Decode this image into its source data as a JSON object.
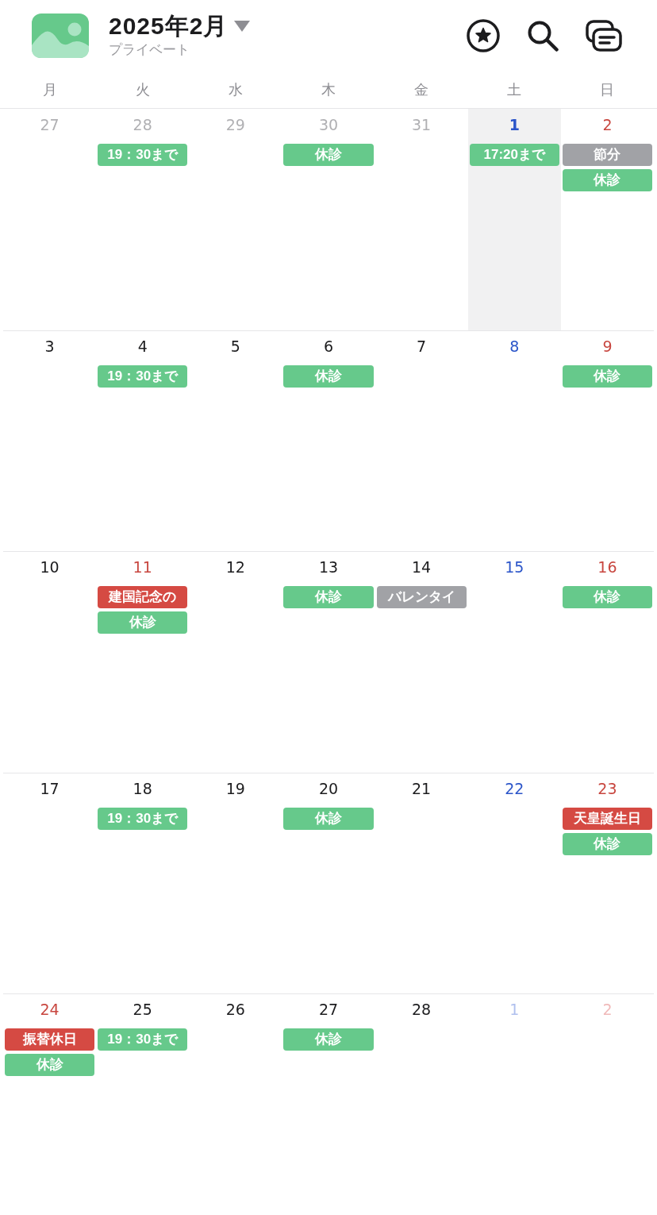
{
  "header": {
    "title": "2025年2月",
    "subtitle": "プライベート"
  },
  "weekdays": [
    "月",
    "火",
    "水",
    "木",
    "金",
    "土",
    "日"
  ],
  "weeks": [
    {
      "days": [
        {
          "date": "27",
          "kind": "weekday",
          "outside": true,
          "selected": false
        },
        {
          "date": "28",
          "kind": "weekday",
          "outside": true,
          "selected": false,
          "events": [
            {
              "title": "19：30まで",
              "color": "#66c98b"
            }
          ]
        },
        {
          "date": "29",
          "kind": "weekday",
          "outside": true,
          "selected": false
        },
        {
          "date": "30",
          "kind": "weekday",
          "outside": true,
          "selected": false,
          "events": [
            {
              "title": "休診",
              "color": "#66c98b"
            }
          ]
        },
        {
          "date": "31",
          "kind": "weekday",
          "outside": true,
          "selected": false
        },
        {
          "date": "1",
          "kind": "saturday",
          "outside": false,
          "selected": true,
          "events": [
            {
              "title": "17:20まで",
              "color": "#66c98b"
            }
          ]
        },
        {
          "date": "2",
          "kind": "holiday",
          "outside": false,
          "selected": false,
          "events": [
            {
              "title": "節分",
              "color": "#a1a2a6"
            },
            {
              "title": "休診",
              "color": "#66c98b"
            }
          ]
        }
      ]
    },
    {
      "days": [
        {
          "date": "3",
          "kind": "weekday",
          "outside": false,
          "selected": false
        },
        {
          "date": "4",
          "kind": "weekday",
          "outside": false,
          "selected": false,
          "events": [
            {
              "title": "19：30まで",
              "color": "#66c98b"
            }
          ]
        },
        {
          "date": "5",
          "kind": "weekday",
          "outside": false,
          "selected": false
        },
        {
          "date": "6",
          "kind": "weekday",
          "outside": false,
          "selected": false,
          "events": [
            {
              "title": "休診",
              "color": "#66c98b"
            }
          ]
        },
        {
          "date": "7",
          "kind": "weekday",
          "outside": false,
          "selected": false
        },
        {
          "date": "8",
          "kind": "saturday",
          "outside": false,
          "selected": false
        },
        {
          "date": "9",
          "kind": "holiday",
          "outside": false,
          "selected": false,
          "events": [
            {
              "title": "休診",
              "color": "#66c98b"
            }
          ]
        }
      ]
    },
    {
      "days": [
        {
          "date": "10",
          "kind": "weekday",
          "outside": false,
          "selected": false
        },
        {
          "date": "11",
          "kind": "holiday",
          "outside": false,
          "selected": false,
          "events": [
            {
              "title": "建国記念の",
              "color": "#d54a43"
            },
            {
              "title": "休診",
              "color": "#66c98b"
            }
          ]
        },
        {
          "date": "12",
          "kind": "weekday",
          "outside": false,
          "selected": false
        },
        {
          "date": "13",
          "kind": "weekday",
          "outside": false,
          "selected": false,
          "events": [
            {
              "title": "休診",
              "color": "#66c98b"
            }
          ]
        },
        {
          "date": "14",
          "kind": "weekday",
          "outside": false,
          "selected": false,
          "events": [
            {
              "title": "バレンタイ",
              "color": "#a1a2a6"
            }
          ]
        },
        {
          "date": "15",
          "kind": "saturday",
          "outside": false,
          "selected": false
        },
        {
          "date": "16",
          "kind": "holiday",
          "outside": false,
          "selected": false,
          "events": [
            {
              "title": "休診",
              "color": "#66c98b"
            }
          ]
        }
      ]
    },
    {
      "days": [
        {
          "date": "17",
          "kind": "weekday",
          "outside": false,
          "selected": false
        },
        {
          "date": "18",
          "kind": "weekday",
          "outside": false,
          "selected": false,
          "events": [
            {
              "title": "19：30まで",
              "color": "#66c98b"
            }
          ]
        },
        {
          "date": "19",
          "kind": "weekday",
          "outside": false,
          "selected": false
        },
        {
          "date": "20",
          "kind": "weekday",
          "outside": false,
          "selected": false,
          "events": [
            {
              "title": "休診",
              "color": "#66c98b"
            }
          ]
        },
        {
          "date": "21",
          "kind": "weekday",
          "outside": false,
          "selected": false
        },
        {
          "date": "22",
          "kind": "saturday",
          "outside": false,
          "selected": false
        },
        {
          "date": "23",
          "kind": "holiday",
          "outside": false,
          "selected": false,
          "events": [
            {
              "title": "天皇誕生日",
              "color": "#d54a43"
            },
            {
              "title": "休診",
              "color": "#66c98b"
            }
          ]
        }
      ]
    },
    {
      "days": [
        {
          "date": "24",
          "kind": "holiday",
          "outside": false,
          "selected": false,
          "events": [
            {
              "title": "振替休日",
              "color": "#d54a43"
            },
            {
              "title": "休診",
              "color": "#66c98b"
            }
          ]
        },
        {
          "date": "25",
          "kind": "weekday",
          "outside": false,
          "selected": false,
          "events": [
            {
              "title": "19：30まで",
              "color": "#66c98b"
            }
          ]
        },
        {
          "date": "26",
          "kind": "weekday",
          "outside": false,
          "selected": false
        },
        {
          "date": "27",
          "kind": "weekday",
          "outside": false,
          "selected": false,
          "events": [
            {
              "title": "休診",
              "color": "#66c98b"
            }
          ]
        },
        {
          "date": "28",
          "kind": "weekday",
          "outside": false,
          "selected": false
        },
        {
          "date": "1",
          "kind": "saturday",
          "outside": true,
          "selected": false
        },
        {
          "date": "2",
          "kind": "holiday",
          "outside": true,
          "selected": false
        }
      ]
    }
  ]
}
